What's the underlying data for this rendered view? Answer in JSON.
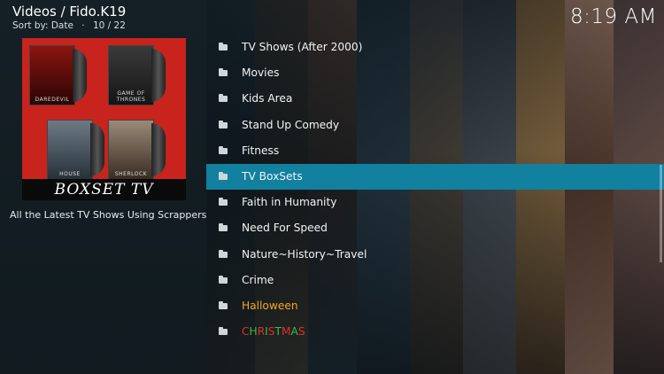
{
  "header": {
    "title": "Videos / Fido.K19",
    "sort_label": "Sort by: Date",
    "separator": "·",
    "position": "10 / 22"
  },
  "clock": "8:19 AM",
  "thumbnail": {
    "banner": "BOXSET TV",
    "cases": [
      "DAREDEVIL",
      "GAME OF THRONES",
      "HOUSE",
      "SHERLOCK"
    ]
  },
  "plot": "All the Latest TV Shows Using Scrappers",
  "list": {
    "items": [
      {
        "label": "TV Shows (After 2000)"
      },
      {
        "label": "Movies"
      },
      {
        "label": "Kids Area"
      },
      {
        "label": "Stand Up Comedy"
      },
      {
        "label": "Fitness"
      },
      {
        "label": "TV BoxSets",
        "focused": true
      },
      {
        "label": "Faith in Humanity"
      },
      {
        "label": "Need For Speed"
      },
      {
        "label": "Nature~History~Travel"
      },
      {
        "label": "Crime"
      },
      {
        "label": "Halloween",
        "color": "#f5a623"
      },
      {
        "label": "CHRISTMAS",
        "style": "christmas"
      }
    ]
  },
  "icons": {
    "folder": "folder-icon"
  },
  "colors": {
    "focus": "#12809f",
    "brand_red": "#c8231c",
    "halloween": "#f5a623",
    "christmas_red": "#e0302a",
    "christmas_green": "#3fb84a"
  }
}
